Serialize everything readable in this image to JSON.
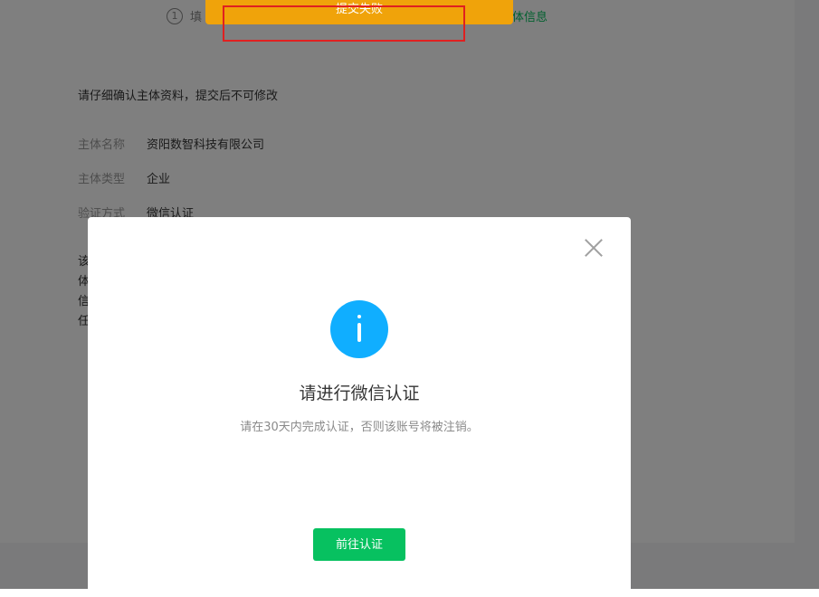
{
  "steps": {
    "step1_number": "1",
    "step1_label": "填",
    "step2_label": "体信息"
  },
  "notice": "请仔细确认主体资料，提交后不可修改",
  "subject": [
    {
      "key": "主体名称",
      "value": "资阳数智科技有限公司"
    },
    {
      "key": "主体类型",
      "value": "企业"
    },
    {
      "key": "验证方式",
      "value": "微信认证"
    }
  ],
  "description_chars": [
    "该",
    "体",
    "信",
    "任"
  ],
  "toast": {
    "text": "提交失败"
  },
  "dialog": {
    "icon": "info-icon",
    "title": "请进行微信认证",
    "subtitle": "请在30天内完成认证，否则该账号将被注销。",
    "button": "前往认证"
  },
  "colors": {
    "primary": "#07c160",
    "info": "#10aeff",
    "warning": "#f0a30a",
    "highlight": "#e02020"
  }
}
